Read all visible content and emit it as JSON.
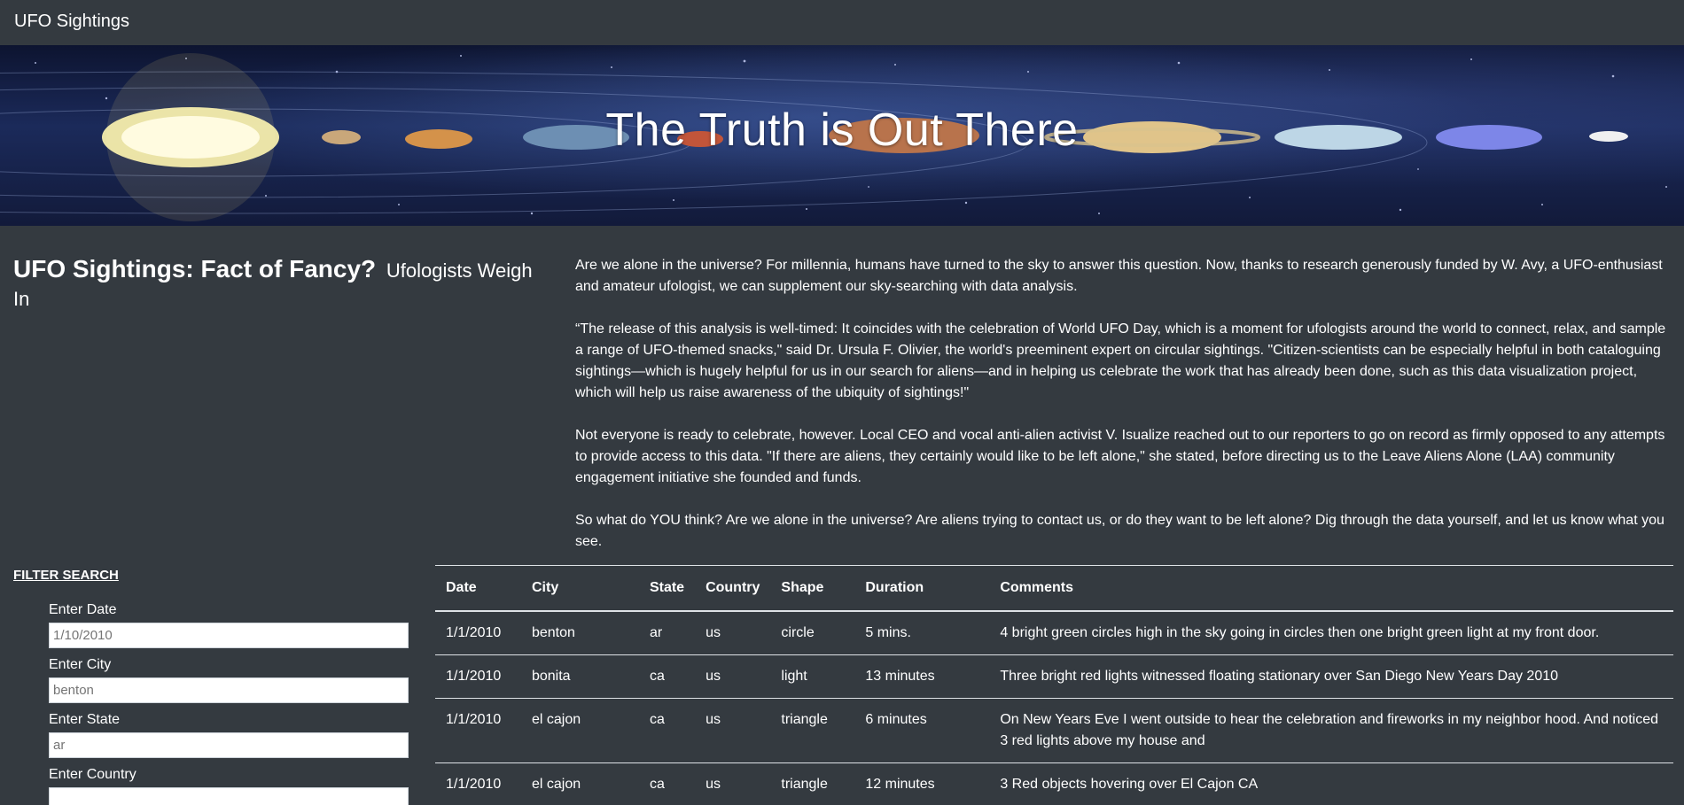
{
  "navbar": {
    "brand": "UFO Sightings"
  },
  "hero": {
    "title": "The Truth is Out There",
    "planet_labels": [
      "Mercury",
      "Venus",
      "Earth",
      "Mars",
      "Jupiter",
      "Saturn",
      "Uranus",
      "Neptune",
      "Pluto"
    ]
  },
  "article": {
    "heading": "UFO Sightings: Fact of Fancy?",
    "subheading": "Ufologists Weigh In",
    "paragraphs": [
      "Are we alone in the universe? For millennia, humans have turned to the sky to answer this question. Now, thanks to research generously funded by W. Avy, a UFO-enthusiast and amateur ufologist, we can supplement our sky-searching with data analysis.",
      "“The release of this analysis is well-timed: It coincides with the celebration of World UFO Day, which is a moment for ufologists around the world to connect, relax, and sample a range of UFO-themed snacks,\" said Dr. Ursula F. Olivier, the world's preeminent expert on circular sightings. \"Citizen-scientists can be especially helpful in both cataloguing sightings—which is hugely helpful for us in our search for aliens—and in helping us celebrate the work that has already been done, such as this data visualization project, which will help us raise awareness of the ubiquity of sightings!\"",
      "Not everyone is ready to celebrate, however. Local CEO and vocal anti-alien activist V. Isualize reached out to our reporters to go on record as firmly opposed to any attempts to provide access to this data. \"If there are aliens, they certainly would like to be left alone,\" she stated, before directing us to the Leave Aliens Alone (LAA) community engagement initiative she founded and funds.",
      "So what do YOU think? Are we alone in the universe? Are aliens trying to contact us, or do they want to be left alone? Dig through the data yourself, and let us know what you see."
    ]
  },
  "filters": {
    "title": "FILTER SEARCH",
    "items": [
      {
        "label": "Enter Date",
        "placeholder": "1/10/2010"
      },
      {
        "label": "Enter City",
        "placeholder": "benton"
      },
      {
        "label": "Enter State",
        "placeholder": "ar"
      },
      {
        "label": "Enter Country",
        "placeholder": ""
      }
    ]
  },
  "table": {
    "headers": [
      "Date",
      "City",
      "State",
      "Country",
      "Shape",
      "Duration",
      "Comments"
    ],
    "rows": [
      [
        "1/1/2010",
        "benton",
        "ar",
        "us",
        "circle",
        "5 mins.",
        "4 bright green circles high in the sky going in circles then one bright green light at my front door."
      ],
      [
        "1/1/2010",
        "bonita",
        "ca",
        "us",
        "light",
        "13 minutes",
        "Three bright red lights witnessed floating stationary over San Diego New Years Day 2010"
      ],
      [
        "1/1/2010",
        "el cajon",
        "ca",
        "us",
        "triangle",
        "6 minutes",
        "On New Years Eve I went outside to hear the celebration and fireworks in my neighbor hood. And noticed 3 red lights above my house and"
      ],
      [
        "1/1/2010",
        "el cajon",
        "ca",
        "us",
        "triangle",
        "12 minutes",
        "3 Red objects hovering over El Cajon CA"
      ]
    ]
  }
}
